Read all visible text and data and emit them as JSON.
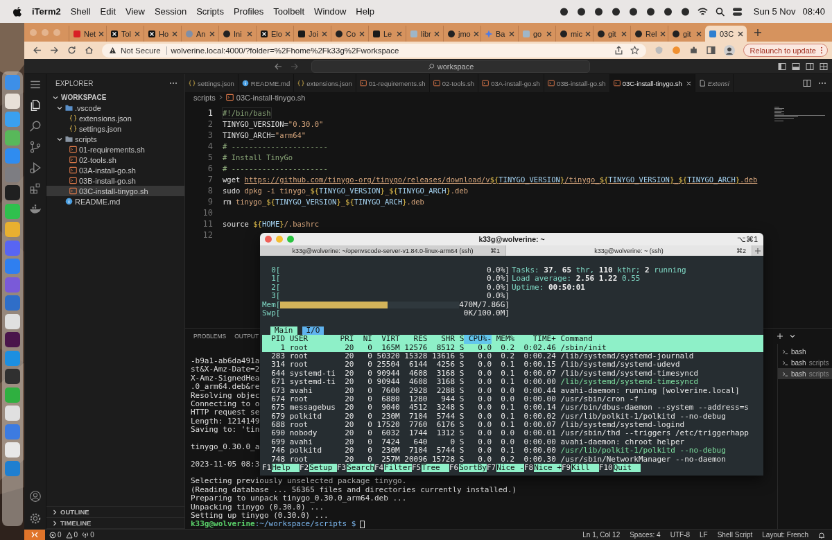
{
  "menu_bar": {
    "app": "iTerm2",
    "menus": [
      "Shell",
      "Edit",
      "View",
      "Session",
      "Scripts",
      "Profiles",
      "Toolbelt",
      "Window",
      "Help"
    ],
    "date": "Sun 5 Nov",
    "time": "08:40"
  },
  "browser": {
    "tabs": [
      {
        "title": "Net",
        "kind": "netflix",
        "selected": false
      },
      {
        "title": "Tol",
        "kind": "x",
        "selected": false
      },
      {
        "title": "Ho",
        "kind": "x",
        "selected": false
      },
      {
        "title": "An",
        "kind": "globe",
        "selected": false
      },
      {
        "title": "Ini",
        "kind": "github",
        "selected": false
      },
      {
        "title": "Elo",
        "kind": "x",
        "selected": false
      },
      {
        "title": "Joi",
        "kind": "dark",
        "selected": false
      },
      {
        "title": "Co",
        "kind": "github",
        "selected": false
      },
      {
        "title": "Le",
        "kind": "dark",
        "selected": false
      },
      {
        "title": "libr",
        "kind": "page",
        "selected": false
      },
      {
        "title": "jmo",
        "kind": "github",
        "selected": false
      },
      {
        "title": "Ba",
        "kind": "sparkle",
        "selected": false
      },
      {
        "title": "go",
        "kind": "page",
        "selected": false
      },
      {
        "title": "mic",
        "kind": "github",
        "selected": false
      },
      {
        "title": "git",
        "kind": "github",
        "selected": false
      },
      {
        "title": "Rel",
        "kind": "github",
        "selected": false
      },
      {
        "title": "git",
        "kind": "github",
        "selected": false
      },
      {
        "title": "03C",
        "kind": "vscode",
        "selected": true
      }
    ],
    "security": "Not Secure",
    "url": "wolverine.local:4000/?folder=%2Fhome%2Fk33g%2Fworkspace",
    "update_button": "Relaunch to update"
  },
  "vscode": {
    "search": "workspace",
    "explorer": {
      "title": "EXPLORER",
      "tree": [
        {
          "label": "WORKSPACE",
          "kind": "root",
          "expanded": true,
          "selected": false,
          "children": [
            {
              "label": ".vscode",
              "kind": "folder",
              "expanded": true,
              "selected": false,
              "children": [
                {
                  "label": "extensions.json",
                  "kind": "json",
                  "selected": false
                },
                {
                  "label": "settings.json",
                  "kind": "json",
                  "selected": false
                }
              ]
            },
            {
              "label": "scripts",
              "kind": "folder",
              "expanded": true,
              "selected": false,
              "children": [
                {
                  "label": "01-requirements.sh",
                  "kind": "shell",
                  "selected": false
                },
                {
                  "label": "02-tools.sh",
                  "kind": "shell",
                  "selected": false
                },
                {
                  "label": "03A-install-go.sh",
                  "kind": "shell",
                  "selected": false
                },
                {
                  "label": "03B-install-go.sh",
                  "kind": "shell",
                  "selected": false
                },
                {
                  "label": "03C-install-tinygo.sh",
                  "kind": "shell",
                  "selected": true
                }
              ]
            },
            {
              "label": "README.md",
              "kind": "markdown",
              "selected": false
            }
          ]
        }
      ],
      "sections": [
        {
          "label": "OUTLINE",
          "expanded": false
        },
        {
          "label": "TIMELINE",
          "expanded": false
        }
      ]
    },
    "tabs": [
      {
        "label": "settings.json",
        "kind": "json",
        "selected": false
      },
      {
        "label": "README.md",
        "kind": "markdown",
        "selected": false
      },
      {
        "label": "extensions.json",
        "kind": "json",
        "selected": false
      },
      {
        "label": "01-requirements.sh",
        "kind": "shell",
        "selected": false
      },
      {
        "label": "02-tools.sh",
        "kind": "shell",
        "selected": false
      },
      {
        "label": "03A-install-go.sh",
        "kind": "shell",
        "selected": false
      },
      {
        "label": "03B-install-go.sh",
        "kind": "shell",
        "selected": false
      },
      {
        "label": "03C-install-tinygo.sh",
        "kind": "shell",
        "selected": true
      },
      {
        "label": "Extensi",
        "kind": "preview",
        "selected": false
      }
    ],
    "breadcrumb": [
      "scripts",
      "03C-install-tinygo.sh"
    ],
    "lines": [
      {
        "number": "1",
        "current": true,
        "tokens": [
          {
            "kind": "comment",
            "text": "#!/bin/bash"
          }
        ]
      },
      {
        "number": "2",
        "current": false,
        "tokens": [
          {
            "kind": "plain",
            "text": "TINYGO_VERSION="
          },
          {
            "kind": "string",
            "text": "\"0.30.0\""
          }
        ]
      },
      {
        "number": "3",
        "current": false,
        "tokens": [
          {
            "kind": "plain",
            "text": "TINYGO_ARCH="
          },
          {
            "kind": "string",
            "text": "\"arm64\""
          }
        ]
      },
      {
        "number": "4",
        "current": false,
        "tokens": [
          {
            "kind": "comment",
            "text": "# ----------------------"
          }
        ]
      },
      {
        "number": "5",
        "current": false,
        "tokens": [
          {
            "kind": "comment",
            "text": "# Install TinyGo"
          }
        ]
      },
      {
        "number": "6",
        "current": false,
        "tokens": [
          {
            "kind": "comment",
            "text": "# ----------------------"
          }
        ]
      },
      {
        "number": "7",
        "current": false,
        "tokens": [
          {
            "kind": "plain",
            "text": "wget "
          },
          {
            "kind": "url",
            "text": "https://github.com/tinygo-org/tinygo/releases/download/v"
          },
          {
            "kind": "link-brace",
            "text": "${"
          },
          {
            "kind": "link-var",
            "text": "TINYGO_VERSION"
          },
          {
            "kind": "link-brace",
            "text": "}"
          },
          {
            "kind": "url",
            "text": "/tinygo_"
          },
          {
            "kind": "link-brace",
            "text": "${"
          },
          {
            "kind": "link-var",
            "text": "TINYGO_VERSION"
          },
          {
            "kind": "link-brace",
            "text": "}"
          },
          {
            "kind": "url",
            "text": "_"
          },
          {
            "kind": "link-brace",
            "text": "${"
          },
          {
            "kind": "link-var",
            "text": "TINYGO_ARCH"
          },
          {
            "kind": "link-brace",
            "text": "}"
          },
          {
            "kind": "url",
            "text": ".deb"
          }
        ]
      },
      {
        "number": "8",
        "current": false,
        "tokens": [
          {
            "kind": "plain",
            "text": "sudo "
          },
          {
            "kind": "arg",
            "text": "dpkg -i tinygo_"
          },
          {
            "kind": "brace",
            "text": "${"
          },
          {
            "kind": "var",
            "text": "TINYGO_VERSION"
          },
          {
            "kind": "brace",
            "text": "}"
          },
          {
            "kind": "arg",
            "text": "_"
          },
          {
            "kind": "brace",
            "text": "${"
          },
          {
            "kind": "var",
            "text": "TINYGO_ARCH"
          },
          {
            "kind": "brace",
            "text": "}"
          },
          {
            "kind": "arg",
            "text": ".deb"
          }
        ]
      },
      {
        "number": "9",
        "current": false,
        "tokens": [
          {
            "kind": "plain",
            "text": "rm "
          },
          {
            "kind": "arg",
            "text": "tinygo_"
          },
          {
            "kind": "brace",
            "text": "${"
          },
          {
            "kind": "var",
            "text": "TINYGO_VERSION"
          },
          {
            "kind": "brace",
            "text": "}"
          },
          {
            "kind": "arg",
            "text": "_"
          },
          {
            "kind": "brace",
            "text": "${"
          },
          {
            "kind": "var",
            "text": "TINYGO_ARCH"
          },
          {
            "kind": "brace",
            "text": "}"
          },
          {
            "kind": "arg",
            "text": ".deb"
          }
        ]
      },
      {
        "number": "10",
        "current": false
      },
      {
        "number": "11",
        "current": false,
        "tokens": [
          {
            "kind": "plain",
            "text": "source "
          },
          {
            "kind": "brace",
            "text": "${"
          },
          {
            "kind": "var",
            "text": "HOME"
          },
          {
            "kind": "brace",
            "text": "}"
          },
          {
            "kind": "arg",
            "text": "/.bashrc"
          }
        ]
      },
      {
        "number": "12",
        "current": false
      }
    ],
    "panel": {
      "tabs": [
        "PROBLEMS",
        "OUTPUT"
      ],
      "lines": [
        {
          "kind": "line",
          "text": "-b9a1-ab6da491a"
        },
        {
          "kind": "line",
          "text": "st&X-Amz-Date=2"
        },
        {
          "kind": "line",
          "text": "X-Amz-SignedHea"
        },
        {
          "kind": "line",
          "text": ".0_arm64.deb&re"
        },
        {
          "kind": "line",
          "text": "Resolving objec"
        },
        {
          "kind": "line",
          "text": "Connecting to o"
        },
        {
          "kind": "line",
          "text": "HTTP request se"
        },
        {
          "kind": "line",
          "text": "Length: 1214149"
        },
        {
          "kind": "line",
          "text": "Saving to: 'tin"
        },
        {
          "kind": "blank"
        },
        {
          "kind": "line",
          "text": "tinygo_0.30.0_a"
        },
        {
          "kind": "blank"
        },
        {
          "kind": "line",
          "text": "2023-11-05 08:3"
        },
        {
          "kind": "blank"
        },
        {
          "kind": "line",
          "text": "Selecting previously unselected package tinygo."
        },
        {
          "kind": "line",
          "text": "(Reading database ... 56365 files and directories currently installed.)"
        },
        {
          "kind": "line",
          "text": "Preparing to unpack tinygo_0.30.0_arm64.deb ..."
        },
        {
          "kind": "line",
          "text": "Unpacking tinygo (0.30.0) ..."
        },
        {
          "kind": "line",
          "text": "Setting up tinygo (0.30.0) ..."
        }
      ],
      "prompt": "**k33g@wolverine**:~/workspace/scripts $",
      "terminals": [
        {
          "name": "bash",
          "selected": false
        },
        {
          "name": "bash",
          "folder": "scripts",
          "selected": false
        },
        {
          "name": "bash",
          "folder": "scripts",
          "selected": true
        }
      ]
    },
    "status_bar": {
      "problems": [
        {
          "kind": "error",
          "count": "0"
        },
        {
          "kind": "warning",
          "count": "0"
        },
        {
          "kind": "ports",
          "count": "0"
        }
      ],
      "items": [
        "Ln 1, Col 12",
        "Spaces: 4",
        "UTF-8",
        "LF",
        "Shell Script",
        "Layout: French"
      ]
    }
  },
  "iterm": {
    "title": "k33g@wolverine: ~",
    "shortcut": "⌥⌘1",
    "tabs": [
      {
        "label": "k33g@wolverine: ~/openvscode-server-v1.84.0-linux-arm64 (ssh)",
        "shortcut": "⌘1",
        "selected": false
      },
      {
        "label": "k33g@wolverine: ~ (ssh)",
        "shortcut": "⌘2",
        "selected": true
      }
    ],
    "meters": [
      {
        "label": "0[",
        "value": "0.0%]"
      },
      {
        "label": "1[",
        "value": "0.0%]"
      },
      {
        "label": "2[",
        "value": "0.0%]"
      },
      {
        "label": "3[",
        "value": "0.0%]"
      },
      {
        "label": "Mem[",
        "value": "470M/7.86G]",
        "level": 0.6
      },
      {
        "label": "Swp[",
        "value": "0K/100.0M]"
      }
    ],
    "summary": [
      "Tasks: **37**, **65** thr, **110** kthr; **2** running",
      "Load average: **2.56** **1.22** 0.55",
      "Uptime: **00:50:01**"
    ],
    "tabs_htop": [
      {
        "label": "Main",
        "selected": true
      },
      {
        "label": "I/O",
        "selected": false
      }
    ],
    "columns": [
      {
        "label": "PID",
        "sorted": false
      },
      {
        "label": "USER",
        "sorted": false
      },
      {
        "label": "PRI",
        "sorted": false
      },
      {
        "label": "NI",
        "sorted": false
      },
      {
        "label": "VIRT",
        "sorted": false
      },
      {
        "label": "RES",
        "sorted": false
      },
      {
        "label": "SHR",
        "sorted": false
      },
      {
        "label": "S",
        "sorted": false
      },
      {
        "label": "CPU%-",
        "sorted": true
      },
      {
        "label": "MEM%",
        "sorted": false
      },
      {
        "label": "TIME+",
        "sorted": false
      },
      {
        "label": "Command",
        "sorted": false
      }
    ],
    "rows": [
      {
        "cells": [
          "1",
          "root",
          "20",
          "0",
          "165M",
          "12576",
          "8512",
          "S",
          "0.0",
          "0.2",
          "0:02.46",
          "/sbin/init"
        ],
        "selected": true,
        "thread": false
      },
      {
        "cells": [
          "283",
          "root",
          "20",
          "0",
          "50320",
          "15328",
          "13616",
          "S",
          "0.0",
          "0.2",
          "0:00.24",
          "/lib/systemd/systemd-journald"
        ],
        "selected": false,
        "thread": false
      },
      {
        "cells": [
          "314",
          "root",
          "20",
          "0",
          "25504",
          "6144",
          "4256",
          "S",
          "0.0",
          "0.1",
          "0:00.15",
          "/lib/systemd/systemd-udevd"
        ],
        "selected": false,
        "thread": false
      },
      {
        "cells": [
          "644",
          "systemd-ti",
          "20",
          "0",
          "90944",
          "4608",
          "3168",
          "S",
          "0.0",
          "0.1",
          "0:00.07",
          "/lib/systemd/systemd-timesyncd"
        ],
        "selected": false,
        "thread": false
      },
      {
        "cells": [
          "671",
          "systemd-ti",
          "20",
          "0",
          "90944",
          "4608",
          "3168",
          "S",
          "0.0",
          "0.1",
          "0:00.00",
          "/lib/systemd/systemd-timesyncd"
        ],
        "selected": false,
        "thread": true
      },
      {
        "cells": [
          "673",
          "avahi",
          "20",
          "0",
          "7600",
          "2928",
          "2288",
          "S",
          "0.0",
          "0.0",
          "0:00.44",
          "avahi-daemon: running [wolverine.local]"
        ],
        "selected": false,
        "thread": false
      },
      {
        "cells": [
          "674",
          "root",
          "20",
          "0",
          "6880",
          "1280",
          "944",
          "S",
          "0.0",
          "0.0",
          "0:00.00",
          "/usr/sbin/cron -f"
        ],
        "selected": false,
        "thread": false
      },
      {
        "cells": [
          "675",
          "messagebus",
          "20",
          "0",
          "9040",
          "4512",
          "3248",
          "S",
          "0.0",
          "0.1",
          "0:00.14",
          "/usr/bin/dbus-daemon --system --address=s"
        ],
        "selected": false,
        "thread": false
      },
      {
        "cells": [
          "679",
          "polkitd",
          "20",
          "0",
          "230M",
          "7104",
          "5744",
          "S",
          "0.0",
          "0.1",
          "0:00.02",
          "/usr/lib/polkit-1/polkitd --no-debug"
        ],
        "selected": false,
        "thread": false
      },
      {
        "cells": [
          "688",
          "root",
          "20",
          "0",
          "17520",
          "7760",
          "6176",
          "S",
          "0.0",
          "0.1",
          "0:00.07",
          "/lib/systemd/systemd-logind"
        ],
        "selected": false,
        "thread": false
      },
      {
        "cells": [
          "690",
          "nobody",
          "20",
          "0",
          "6032",
          "1744",
          "1312",
          "S",
          "0.0",
          "0.0",
          "0:00.01",
          "/usr/sbin/thd --triggers /etc/triggerhapp"
        ],
        "selected": false,
        "thread": false
      },
      {
        "cells": [
          "699",
          "avahi",
          "20",
          "0",
          "7424",
          "640",
          "0",
          "S",
          "0.0",
          "0.0",
          "0:00.00",
          "avahi-daemon: chroot helper"
        ],
        "selected": false,
        "thread": false
      },
      {
        "cells": [
          "746",
          "polkitd",
          "20",
          "0",
          "230M",
          "7104",
          "5744",
          "S",
          "0.0",
          "0.1",
          "0:00.00",
          "/usr/lib/polkit-1/polkitd --no-debug"
        ],
        "selected": false,
        "thread": true
      },
      {
        "cells": [
          "748",
          "root",
          "20",
          "0",
          "257M",
          "20096",
          "15728",
          "S",
          "0.0",
          "0.2",
          "0:00.30",
          "/usr/sbin/NetworkManager --no-daemon"
        ],
        "selected": false,
        "thread": false
      }
    ],
    "keys": [
      {
        "key": "F1",
        "label": "Help"
      },
      {
        "key": "F2",
        "label": "Setup"
      },
      {
        "key": "F3",
        "label": "Search"
      },
      {
        "key": "F4",
        "label": "Filter"
      },
      {
        "key": "F5",
        "label": "Tree"
      },
      {
        "key": "F6",
        "label": "SortBy"
      },
      {
        "key": "F7",
        "label": "Nice -"
      },
      {
        "key": "F8",
        "label": "Nice +"
      },
      {
        "key": "F9",
        "label": "Kill"
      },
      {
        "key": "F10",
        "label": "Quit"
      }
    ]
  }
}
